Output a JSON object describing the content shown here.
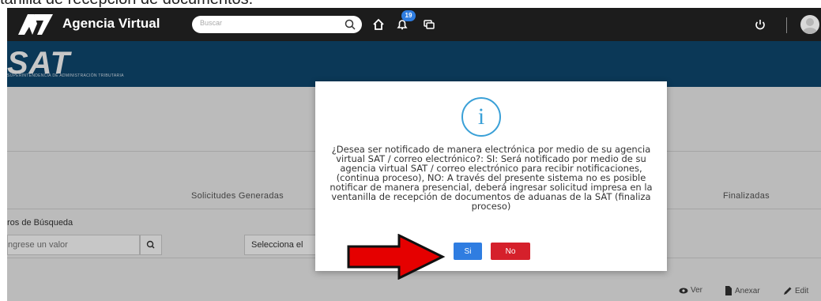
{
  "document": {
    "caption": "tanilla de recepción de documentos."
  },
  "topbar": {
    "title": "Agencia Virtual",
    "search_placeholder": "Buscar",
    "notifications_count": "19",
    "icons": [
      "home-icon",
      "bell-icon",
      "chat-icon",
      "power-icon",
      "user-avatar"
    ]
  },
  "brand": {
    "logo_text": "SAT",
    "subtitle": "Superintendencia de Administración Tributaria"
  },
  "tabs": {
    "generated": "Solicitudes Generadas",
    "finalized": "Finalizadas"
  },
  "filters": {
    "label": "ros de Búsqueda",
    "value_placeholder": "ngrese un valor",
    "select_label": "Selecciona el"
  },
  "actions": {
    "view": "Ver",
    "attach": "Anexar",
    "edit": "Edit"
  },
  "modal": {
    "icon": "info-icon",
    "icon_char": "i",
    "message": "¿Desea ser notificado de manera electrónica por medio de su agencia virtual SAT / correo electrónico?: SI: Será notificado por medio de su agencia virtual SAT / correo electrónico para recibir notificaciones, (continua proceso), NO: A través del presente sistema no es posible notificar de manera presencial, deberá ingresar solicitud impresa en la ventanilla de recepción de documentos de aduanas de la SAT (finaliza proceso)",
    "yes_label": "Si",
    "no_label": "No"
  },
  "colors": {
    "topbar": "#1c1c1c",
    "brandbar": "#0f4870",
    "primary": "#2f7de1",
    "danger": "#d5202b",
    "info": "#3aa0d7",
    "arrow": "#e50000"
  }
}
